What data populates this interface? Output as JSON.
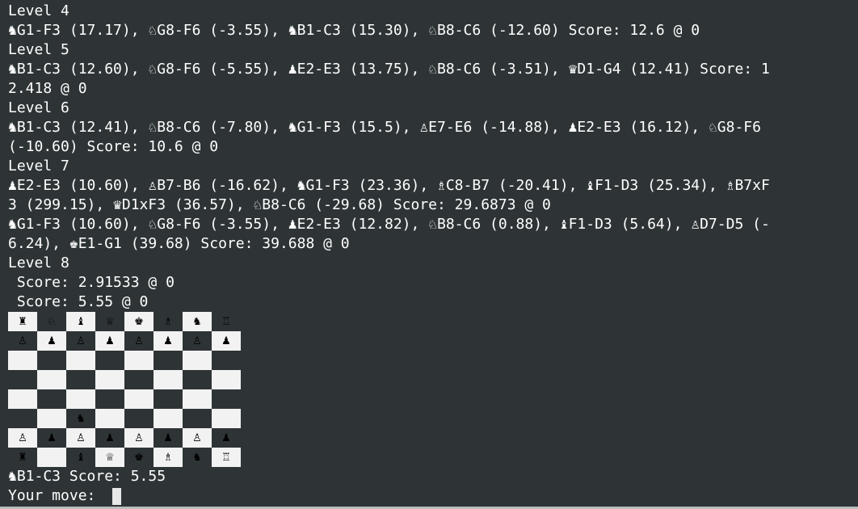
{
  "lines_before": [
    "Level 4",
    "♞G1-F3 (17.17), ♘G8-F6 (-3.55), ♞B1-C3 (15.30), ♘B8-C6 (-12.60) Score: 12.6 @ 0",
    "Level 5",
    "♞B1-C3 (12.60), ♘G8-F6 (-5.55), ♟E2-E3 (13.75), ♘B8-C6 (-3.51), ♛D1-G4 (12.41) Score: 1",
    "2.418 @ 0",
    "Level 6",
    "♞B1-C3 (12.41), ♘B8-C6 (-7.80), ♞G1-F3 (15.5), ♙E7-E6 (-14.88), ♟E2-E3 (16.12), ♘G8-F6",
    "(-10.60) Score: 10.6 @ 0",
    "Level 7",
    "♟E2-E3 (10.60), ♙B7-B6 (-16.62), ♞G1-F3 (23.36), ♗C8-B7 (-20.41), ♝F1-D3 (25.34), ♗B7xF",
    "3 (299.15), ♛D1xF3 (36.57), ♘B8-C6 (-29.68) Score: 29.6873 @ 0",
    "♞G1-F3 (10.60), ♘G8-F6 (-3.55), ♟E2-E3 (12.82), ♘B8-C6 (0.88), ♝F1-D3 (5.64), ♙D7-D5 (-",
    "6.24), ♚E1-G1 (39.68) Score: 39.688 @ 0",
    "Level 8",
    " Score: 2.91533 @ 0",
    " Score: 5.55 @ 0"
  ],
  "board": [
    [
      "♜",
      "♘",
      "♝",
      "♕",
      "♚",
      "♗",
      "♞",
      "♖"
    ],
    [
      "♙",
      "♟",
      "♙",
      "♟",
      "♙",
      "♟",
      "♙",
      "♟"
    ],
    [
      "",
      "",
      "",
      "",
      "",
      "",
      "",
      ""
    ],
    [
      "",
      "",
      "",
      "",
      "",
      "",
      "",
      ""
    ],
    [
      "",
      "",
      "",
      "",
      "",
      "",
      "",
      ""
    ],
    [
      "",
      "",
      "♞",
      "",
      "",
      "",
      "",
      ""
    ],
    [
      "♙",
      "♟",
      "♙",
      "♟",
      "♙",
      "♟",
      "♙",
      "♟"
    ],
    [
      "♜",
      "",
      "♝",
      "♕",
      "♚",
      "♗",
      "♞",
      "♖"
    ]
  ],
  "last_move": "♞B1-C3 Score: 5.55",
  "prompt": "Your move: "
}
